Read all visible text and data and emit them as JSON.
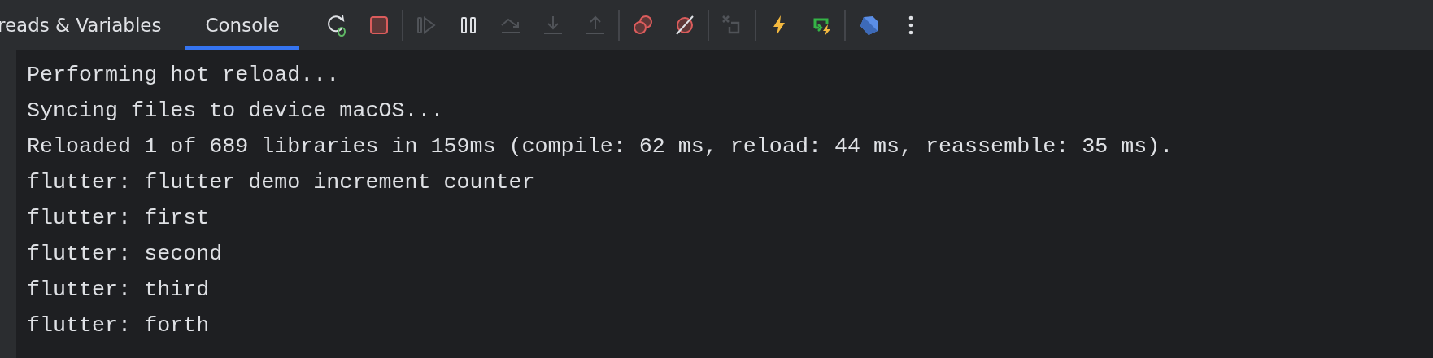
{
  "tabs": [
    {
      "label": "reads & Variables",
      "selected": false
    },
    {
      "label": "Console",
      "selected": true
    }
  ],
  "toolbar": [
    {
      "kind": "button",
      "disabled": false
    },
    {
      "kind": "button",
      "disabled": false
    },
    {
      "kind": "separator"
    },
    {
      "kind": "button",
      "disabled": true
    },
    {
      "kind": "button",
      "disabled": false
    },
    {
      "kind": "button",
      "disabled": true
    },
    {
      "kind": "button",
      "disabled": true
    },
    {
      "kind": "button",
      "disabled": true
    },
    {
      "kind": "separator"
    },
    {
      "kind": "button",
      "disabled": false
    },
    {
      "kind": "button",
      "disabled": false
    },
    {
      "kind": "separator"
    },
    {
      "kind": "button",
      "disabled": true
    },
    {
      "kind": "separator"
    },
    {
      "kind": "button",
      "disabled": false
    },
    {
      "kind": "button",
      "disabled": false
    },
    {
      "kind": "separator"
    },
    {
      "kind": "button",
      "disabled": false
    },
    {
      "kind": "button",
      "disabled": false
    }
  ],
  "console": {
    "lines": [
      "Performing hot reload...",
      "Syncing files to device macOS...",
      "Reloaded 1 of 689 libraries in 159ms (compile: 62 ms, reload: 44 ms, reassemble: 35 ms).",
      "flutter: flutter demo increment counter",
      "flutter: first",
      "flutter: second",
      "flutter: third",
      "flutter: forth"
    ]
  }
}
